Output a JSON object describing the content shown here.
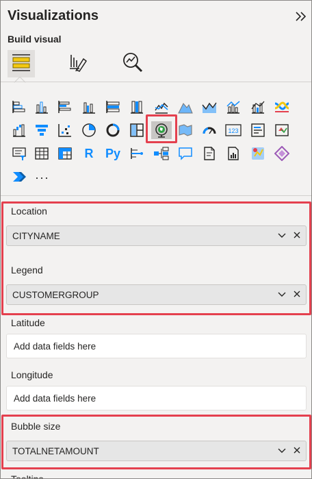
{
  "header": {
    "title": "Visualizations",
    "expand_icon": "double-chevron-right-icon",
    "build_visual_label": "Build visual"
  },
  "modes": [
    "build-visual-icon",
    "format-visual-icon",
    "analytics-icon"
  ],
  "gallery": {
    "selected": "map-globe-icon",
    "more_label": "···",
    "r_label": "R",
    "py_label": "Py",
    "card_number": "123"
  },
  "fields": {
    "location": {
      "label": "Location",
      "value": "CITYNAME"
    },
    "legend": {
      "label": "Legend",
      "value": "CUSTOMERGROUP"
    },
    "latitude": {
      "label": "Latitude",
      "placeholder": "Add data fields here"
    },
    "longitude": {
      "label": "Longitude",
      "placeholder": "Add data fields here"
    },
    "bubble_size": {
      "label": "Bubble size",
      "value": "TOTALNETAMOUNT"
    },
    "tooltips": {
      "label": "Tooltips"
    }
  },
  "colors": {
    "accent_yellow": "#f2c811",
    "highlight_red": "#e4404e",
    "icon_blue": "#118dff",
    "icon_dark": "#252423"
  }
}
